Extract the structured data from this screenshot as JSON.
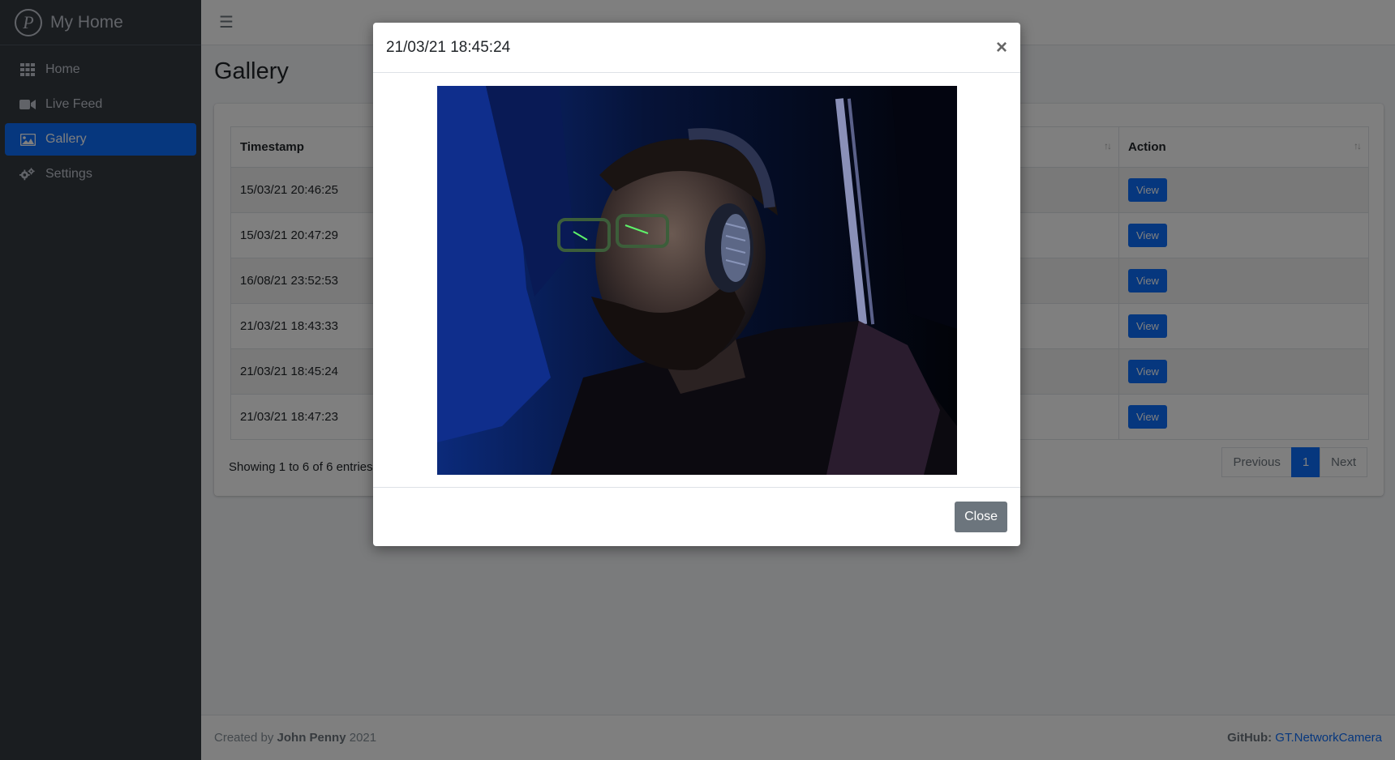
{
  "brand": {
    "logo_letter": "P",
    "name": "My Home"
  },
  "sidebar": {
    "items": [
      {
        "label": "Home",
        "icon": "grid-icon"
      },
      {
        "label": "Live Feed",
        "icon": "video-camera-icon"
      },
      {
        "label": "Gallery",
        "icon": "image-icon",
        "active": true
      },
      {
        "label": "Settings",
        "icon": "gears-icon"
      }
    ]
  },
  "topbar": {
    "menu_icon": "hamburger-icon",
    "menu_glyph": "☰"
  },
  "page": {
    "title": "Gallery"
  },
  "table": {
    "columns": [
      "Timestamp",
      "Action"
    ],
    "sort_glyph": "↑↓",
    "rows": [
      {
        "timestamp": "15/03/21 20:46:25",
        "action": "View"
      },
      {
        "timestamp": "15/03/21 20:47:29",
        "action": "View"
      },
      {
        "timestamp": "16/08/21 23:52:53",
        "action": "View"
      },
      {
        "timestamp": "21/03/21 18:43:33",
        "action": "View"
      },
      {
        "timestamp": "21/03/21 18:45:24",
        "action": "View"
      },
      {
        "timestamp": "21/03/21 18:47:23",
        "action": "View"
      }
    ],
    "info": "Showing 1 to 6 of 6 entries"
  },
  "pagination": {
    "previous": "Previous",
    "current": "1",
    "next": "Next"
  },
  "footer": {
    "created_prefix": "Created by",
    "author": "John Penny",
    "year": "2021",
    "github_label": "GitHub:",
    "github_link": "GT.NetworkCamera"
  },
  "modal": {
    "title": "21/03/21 18:45:24",
    "close_x": "×",
    "close_label": "Close",
    "image_icon": "camera-snapshot"
  },
  "colors": {
    "sidebar": "#343a40",
    "accent": "#0d6efd",
    "secondary": "#6c757d"
  }
}
